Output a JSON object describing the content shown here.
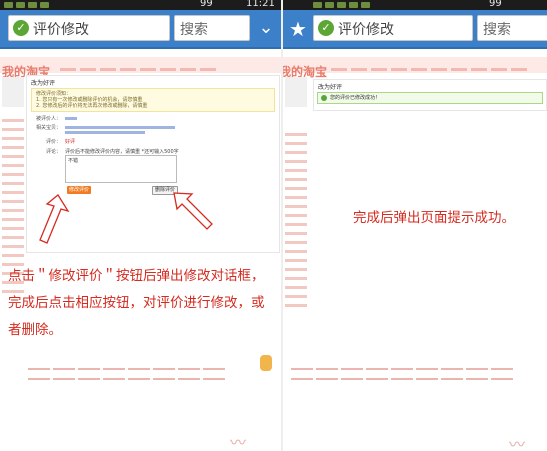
{
  "left_screen": {
    "status_bar": {
      "time": "11:21",
      "battery": "99"
    },
    "url_bar": {
      "text": "评价修改"
    },
    "search_box": {
      "text": "搜索"
    },
    "site": {
      "logo": "我的淘宝"
    },
    "dialog": {
      "title": "改为好评",
      "notice_title": "修改评价须知：",
      "notice_lines": [
        "1. 您只有一次修改或删除评价的机会，请您慎重",
        "2. 您修改后的评价将无法再次修改或删除，请慎重"
      ],
      "fields": [
        {
          "label": "被评价人："
        },
        {
          "label": "相关宝贝："
        },
        {
          "label": "评价：",
          "value": "好评"
        },
        {
          "label": "评论：",
          "value": "评价后不能修改评价内容，请慎重 *还可输入500字"
        }
      ],
      "textarea_value": "不错",
      "modify_button": "修改评价",
      "delete_button": "删除评价"
    },
    "caption": "点击＂修改评价＂按钮后弹出修改对话框，完成后点击相应按钮，对评价进行修改，或者删除。"
  },
  "right_screen": {
    "status_bar": {
      "battery": "99"
    },
    "url_bar": {
      "text": "评价修改"
    },
    "search_box": {
      "text": "搜索"
    },
    "site": {
      "logo": "我的淘宝"
    },
    "dialog": {
      "title": "改为好评",
      "success_message": "您的评价已修改成功！"
    },
    "caption": "完成后弹出页面提示成功。"
  },
  "colors": {
    "browser_bar": "#3b80c8",
    "caption_red": "#d52b20",
    "button_orange": "#f07b22",
    "success_green": "#58a63a"
  }
}
